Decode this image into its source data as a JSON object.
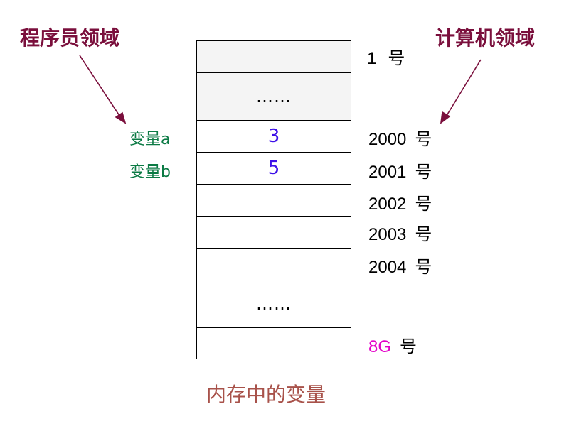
{
  "title_left": "程序员领域",
  "title_right": "计算机领域",
  "memory_cells": [
    {
      "content": "",
      "shaded": true
    },
    {
      "content": "……",
      "shaded": true
    },
    {
      "content": "3",
      "shaded": false
    },
    {
      "content": "5",
      "shaded": false
    },
    {
      "content": "",
      "shaded": false
    },
    {
      "content": "",
      "shaded": false
    },
    {
      "content": "",
      "shaded": false
    },
    {
      "content": "……",
      "shaded": false
    },
    {
      "content": "",
      "shaded": false
    }
  ],
  "variables": {
    "a": "变量a",
    "b": "变量b"
  },
  "addresses": [
    {
      "num": "1",
      "suffix": "号"
    },
    {
      "num": "2000",
      "suffix": "号"
    },
    {
      "num": "2001",
      "suffix": "号"
    },
    {
      "num": "2002",
      "suffix": "号"
    },
    {
      "num": "2003",
      "suffix": "号"
    },
    {
      "num": "2004",
      "suffix": "号"
    },
    {
      "num": "8G",
      "suffix": "号"
    }
  ],
  "caption": "内存中的变量",
  "colors": {
    "title": "#7a0f3c",
    "variable": "#0b7a44",
    "value": "#3d10e8",
    "highlight": "#e300c8",
    "caption": "#a8524a"
  }
}
